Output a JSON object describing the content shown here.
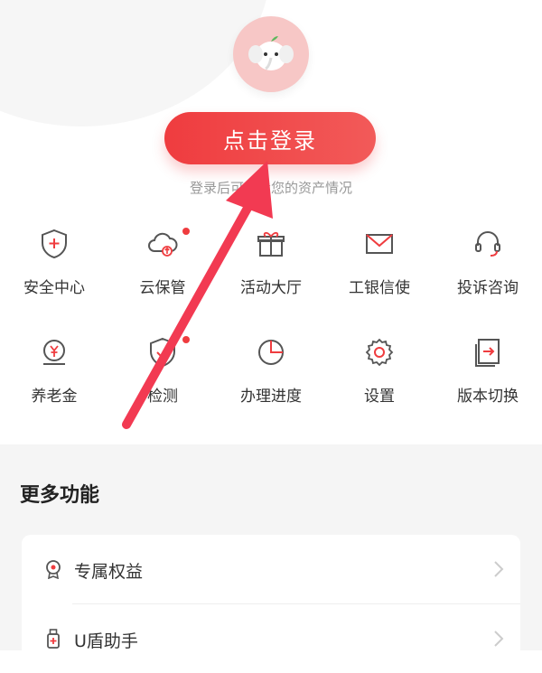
{
  "login": {
    "button_label": "点击登录",
    "hint": "登录后可查看您的资产情况"
  },
  "grid_row1": [
    {
      "label": "安全中心",
      "icon": "shield-plus-icon",
      "badge": false
    },
    {
      "label": "云保管",
      "icon": "cloud-upload-icon",
      "badge": true
    },
    {
      "label": "活动大厅",
      "icon": "gift-icon",
      "badge": false
    },
    {
      "label": "工银信使",
      "icon": "mail-icon",
      "badge": false
    },
    {
      "label": "投诉咨询",
      "icon": "headset-icon",
      "badge": false
    }
  ],
  "grid_row2": [
    {
      "label": "养老金",
      "icon": "pension-coin-icon",
      "badge": false
    },
    {
      "label": "检测",
      "icon": "shield-check-icon",
      "badge": true
    },
    {
      "label": "办理进度",
      "icon": "pie-chart-icon",
      "badge": false
    },
    {
      "label": "设置",
      "icon": "gear-icon",
      "badge": false
    },
    {
      "label": "版本切换",
      "icon": "switch-icon",
      "badge": false
    }
  ],
  "more": {
    "title": "更多功能",
    "items": [
      {
        "label": "专属权益",
        "icon": "medal-icon"
      },
      {
        "label": "U盾助手",
        "icon": "usb-key-icon"
      }
    ]
  },
  "colors": {
    "accent": "#ef3c3f",
    "icon_stroke": "#555555",
    "more_bg": "#f5f5f5"
  }
}
